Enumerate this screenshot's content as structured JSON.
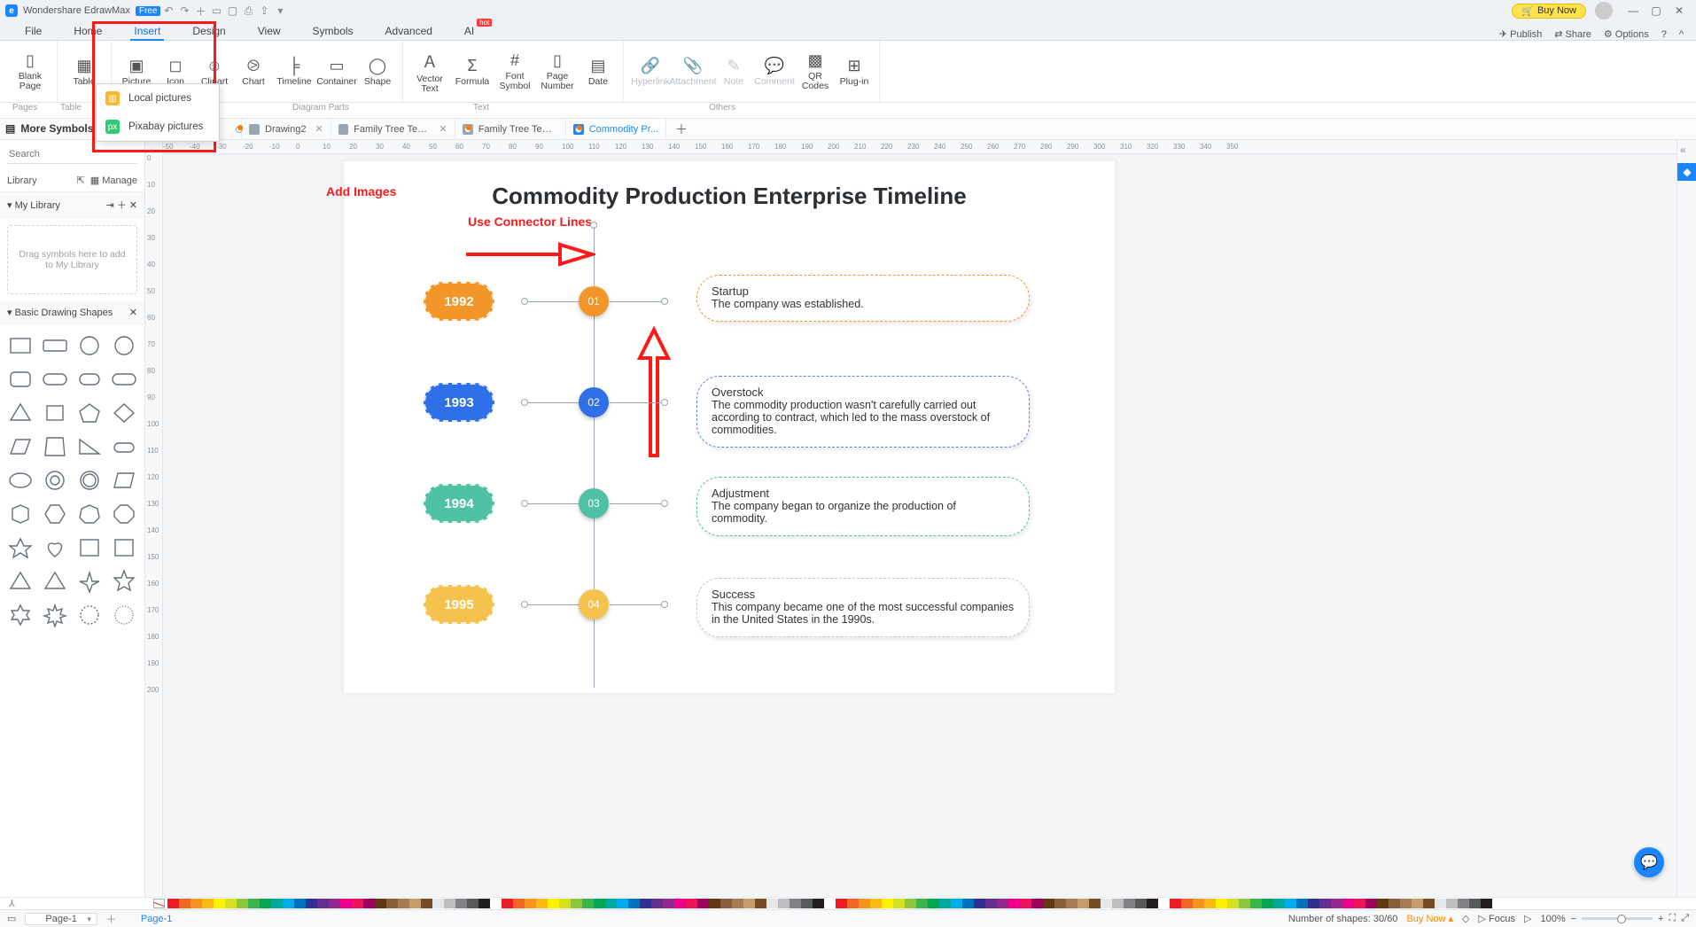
{
  "titlebar": {
    "app": "Wondershare EdrawMax",
    "tag": "Free",
    "buy": "Buy Now"
  },
  "menu": {
    "tabs": [
      "File",
      "Home",
      "Insert",
      "Design",
      "View",
      "Symbols",
      "Advanced",
      "AI"
    ],
    "active": 2,
    "right": {
      "publish": "Publish",
      "share": "Share",
      "options": "Options"
    }
  },
  "ribbon": {
    "buttons": [
      {
        "label": "Blank\nPage",
        "drop": true
      },
      {
        "label": "Table",
        "drop": true
      },
      {
        "label": "Picture",
        "drop": true
      },
      {
        "label": "Icon"
      },
      {
        "label": "Clipart",
        "drop": true
      },
      {
        "label": "Chart"
      },
      {
        "label": "Timeline"
      },
      {
        "label": "Container",
        "drop": true
      },
      {
        "label": "Shape",
        "drop": true
      },
      {
        "label": "Vector\nText"
      },
      {
        "label": "Formula"
      },
      {
        "label": "Font\nSymbol",
        "drop": true
      },
      {
        "label": "Page\nNumber",
        "drop": true
      },
      {
        "label": "Date",
        "drop": true
      },
      {
        "label": "Hyperlink",
        "disabled": true
      },
      {
        "label": "Attachment",
        "disabled": true
      },
      {
        "label": "Note",
        "disabled": true
      },
      {
        "label": "Comment",
        "disabled": true
      },
      {
        "label": "QR\nCodes"
      },
      {
        "label": "Plug-in"
      }
    ],
    "groups": [
      "Pages",
      "Table",
      "",
      "Diagram Parts",
      "",
      "Text",
      "",
      "Others"
    ],
    "dropdown": {
      "local": "Local pictures",
      "pixabay": "Pixabay pictures"
    }
  },
  "more_symbols": "More Symbols",
  "doctabs": [
    {
      "name": "",
      "dot": true,
      "close": false
    },
    {
      "name": "Drawing2",
      "close": true
    },
    {
      "name": "Family Tree Tem...",
      "close": true
    },
    {
      "name": "Family Tree Tem...",
      "dot": true
    },
    {
      "name": "Commodity Pr...",
      "dot": true,
      "active": true
    }
  ],
  "side": {
    "search_ph": "Search",
    "library": "Library",
    "manage": "Manage",
    "mylib": "My Library",
    "mylib_hint": "Drag symbols here to add to My Library",
    "shapes_hdr": "Basic Drawing Shapes"
  },
  "ruler_h": [
    "-50",
    "-40",
    "-30",
    "-20",
    "-10",
    "0",
    "10",
    "20",
    "30",
    "40",
    "50",
    "60",
    "70",
    "80",
    "90",
    "100",
    "110",
    "120",
    "130",
    "140",
    "150",
    "160",
    "170",
    "180",
    "190",
    "200",
    "210",
    "220",
    "230",
    "240",
    "250",
    "260",
    "270",
    "280",
    "290",
    "300",
    "310",
    "320",
    "330",
    "340",
    "350"
  ],
  "ruler_v": [
    "0",
    "10",
    "20",
    "30",
    "40",
    "50",
    "60",
    "70",
    "80",
    "90",
    "100",
    "110",
    "120",
    "130",
    "140",
    "150",
    "160",
    "170",
    "180",
    "190",
    "200"
  ],
  "annotations": {
    "add_images": "Add Images",
    "connector": "Use Connector Lines"
  },
  "timeline": {
    "title": "Commodity Production Enterprise Timeline",
    "items": [
      {
        "year": "1992",
        "num": "01",
        "color": "#f2962a",
        "card_color": "#f2962a",
        "title": "Startup",
        "desc": "The company was established."
      },
      {
        "year": "1993",
        "num": "02",
        "color": "#2f6fe8",
        "card_color": "#5a89d6",
        "title": "Overstock",
        "desc": "The commodity production wasn't carefully carried out according to contract, which led to the mass overstock of commodities."
      },
      {
        "year": "1994",
        "num": "03",
        "color": "#4fc2a6",
        "card_color": "#4fc2a6",
        "title": "Adjustment",
        "desc": "The company began to organize the production of commodity."
      },
      {
        "year": "1995",
        "num": "04",
        "color": "#f5c24e",
        "card_color": "#bfc6cf",
        "title": "Success",
        "desc": "This company became one of the most successful companies in the United States in the 1990s."
      }
    ]
  },
  "colors": [
    "#ed1c24",
    "#f26522",
    "#f7941d",
    "#fdb913",
    "#fff200",
    "#d7df23",
    "#8dc63f",
    "#39b54a",
    "#00a651",
    "#00a99d",
    "#00aeef",
    "#0072bc",
    "#2e3192",
    "#662d91",
    "#92278f",
    "#ec008c",
    "#ed145b",
    "#9e005d",
    "#603913",
    "#8a5d3b",
    "#a67c52",
    "#c69c6d",
    "#754c24",
    "#e6e7e8",
    "#bcbec0",
    "#808285",
    "#58595b",
    "#231f20",
    "#ffffff"
  ],
  "status": {
    "page": "Page-1",
    "pagelink": "Page-1",
    "shapes": "Number of shapes: 30/60",
    "buynow": "Buy Now",
    "focus": "Focus",
    "zoom": "100%"
  }
}
